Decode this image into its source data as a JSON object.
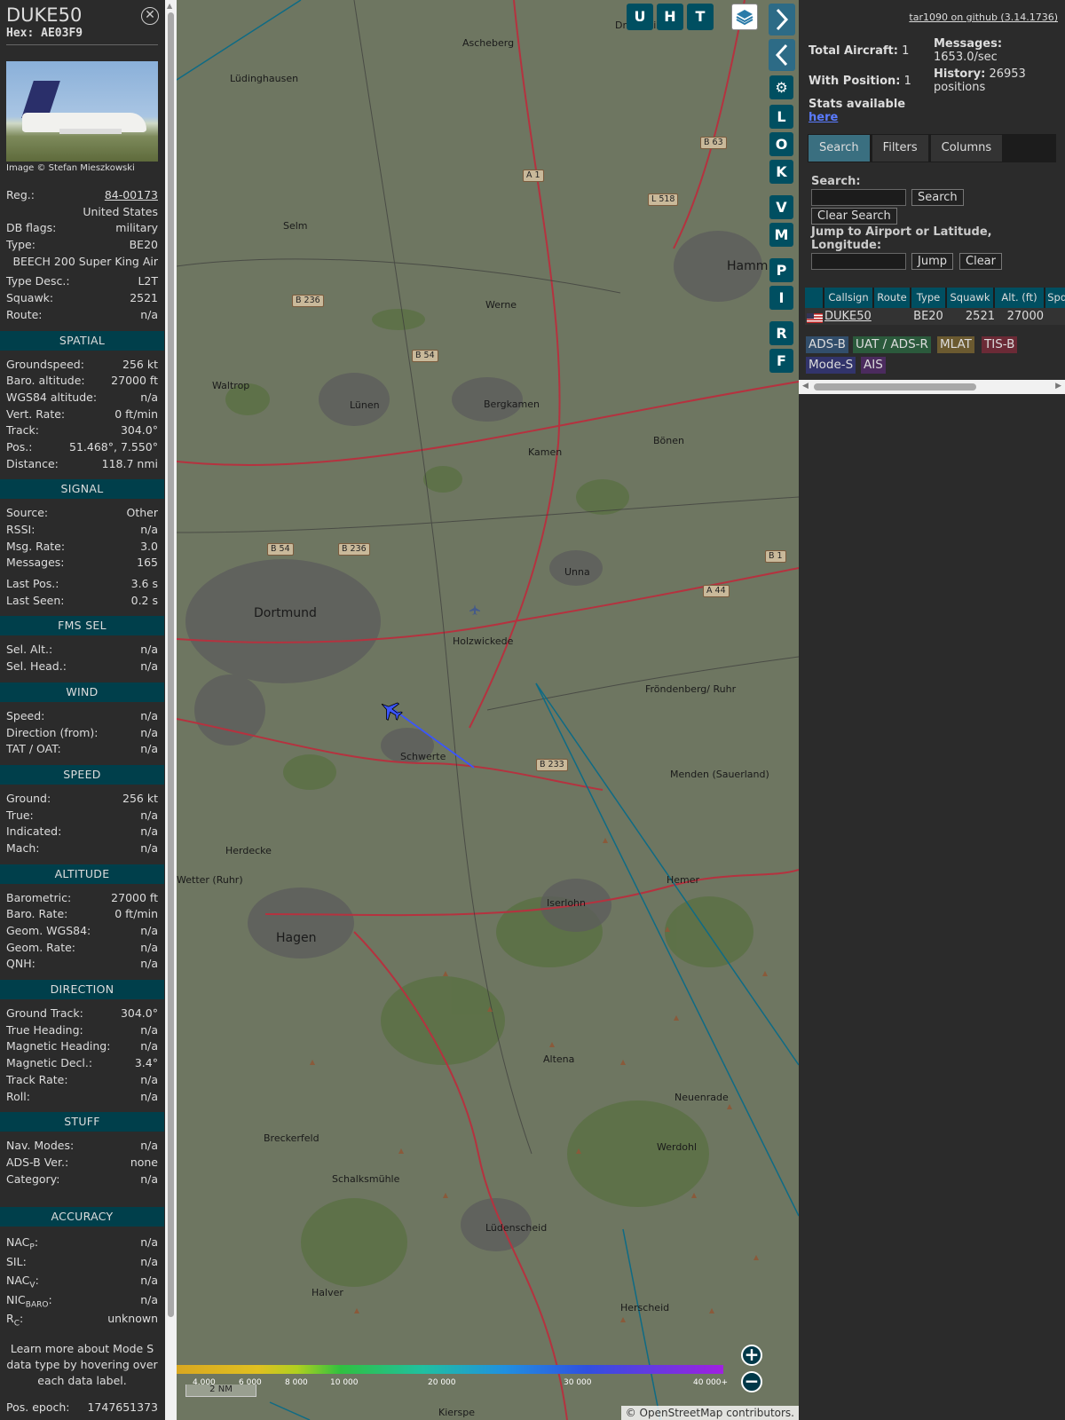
{
  "sidebar": {
    "callsign": "DUKE50",
    "hex": "Hex: AE03F9",
    "image_credit": "Image © Stefan Mieszkowski",
    "identity": [
      {
        "label": "Reg.:",
        "value": "84-00173"
      },
      {
        "label": "",
        "value": "United States"
      },
      {
        "label": "DB flags:",
        "value": "military"
      },
      {
        "label": "Type:",
        "value": "BE20"
      },
      {
        "label": "",
        "value": "BEECH 200 Super King Air"
      },
      {
        "label": "Type Desc.:",
        "value": "L2T"
      },
      {
        "label": "Squawk:",
        "value": "2521"
      },
      {
        "label": "Route:",
        "value": "n/a"
      }
    ],
    "sections": [
      {
        "title": "SPATIAL",
        "rows": [
          {
            "label": "Groundspeed:",
            "value": "256 kt"
          },
          {
            "label": "Baro. altitude:",
            "value": "27000 ft"
          },
          {
            "label": "WGS84 altitude:",
            "value": "n/a"
          },
          {
            "label": "Vert. Rate:",
            "value": "0 ft/min"
          },
          {
            "label": "Track:",
            "value": "304.0°"
          },
          {
            "label": "Pos.:",
            "value": "51.468°, 7.550°"
          },
          {
            "label": "Distance:",
            "value": "118.7 nmi"
          }
        ]
      },
      {
        "title": "SIGNAL",
        "rows": [
          {
            "label": "Source:",
            "value": "Other"
          },
          {
            "label": "RSSI:",
            "value": "n/a"
          },
          {
            "label": "Msg. Rate:",
            "value": "3.0"
          },
          {
            "label": "Messages:",
            "value": "165"
          },
          {
            "label": "Last Pos.:",
            "value": "3.6 s"
          },
          {
            "label": "Last Seen:",
            "value": "0.2 s"
          }
        ]
      },
      {
        "title": "FMS SEL",
        "rows": [
          {
            "label": "Sel. Alt.:",
            "value": "n/a"
          },
          {
            "label": "Sel. Head.:",
            "value": "n/a"
          }
        ]
      },
      {
        "title": "WIND",
        "rows": [
          {
            "label": "Speed:",
            "value": "n/a"
          },
          {
            "label": "Direction (from):",
            "value": "n/a"
          },
          {
            "label": "TAT / OAT:",
            "value": "n/a"
          }
        ]
      },
      {
        "title": "SPEED",
        "rows": [
          {
            "label": "Ground:",
            "value": "256 kt"
          },
          {
            "label": "True:",
            "value": "n/a"
          },
          {
            "label": "Indicated:",
            "value": "n/a"
          },
          {
            "label": "Mach:",
            "value": "n/a"
          }
        ]
      },
      {
        "title": "ALTITUDE",
        "rows": [
          {
            "label": "Barometric:",
            "value": "27000 ft"
          },
          {
            "label": "Baro. Rate:",
            "value": "0 ft/min"
          },
          {
            "label": "Geom. WGS84:",
            "value": "n/a"
          },
          {
            "label": "Geom. Rate:",
            "value": "n/a"
          },
          {
            "label": "QNH:",
            "value": "n/a"
          }
        ]
      },
      {
        "title": "DIRECTION",
        "rows": [
          {
            "label": "Ground Track:",
            "value": "304.0°"
          },
          {
            "label": "True Heading:",
            "value": "n/a"
          },
          {
            "label": "Magnetic Heading:",
            "value": "n/a"
          },
          {
            "label": "Magnetic Decl.:",
            "value": "3.4°"
          },
          {
            "label": "Track Rate:",
            "value": "n/a"
          },
          {
            "label": "Roll:",
            "value": "n/a"
          }
        ]
      },
      {
        "title": "STUFF",
        "rows": [
          {
            "label": "Nav. Modes:",
            "value": "n/a"
          },
          {
            "label": "ADS-B Ver.:",
            "value": "none"
          },
          {
            "label": "Category:",
            "value": "n/a"
          }
        ]
      }
    ],
    "accuracy": {
      "title": "ACCURACY",
      "rows": [
        {
          "label": "NAC",
          "sub": "P",
          "value": "n/a"
        },
        {
          "label": "SIL:",
          "sub": "",
          "value": "n/a"
        },
        {
          "label": "NAC",
          "sub": "V",
          "value": "n/a"
        },
        {
          "label": "NIC",
          "sub": "BARO",
          "value": "n/a"
        },
        {
          "label": "R",
          "sub": "C",
          "value": "unknown"
        }
      ]
    },
    "learn_more": "Learn more about Mode S data type by hovering over each data label.",
    "pos_epoch_label": "Pos. epoch:",
    "pos_epoch_value": "1747651373"
  },
  "map_buttons": {
    "top": [
      "U",
      "H",
      "T"
    ],
    "side": [
      "L",
      "O",
      "K",
      "V",
      "M",
      "P",
      "I",
      "R",
      "F"
    ],
    "icons": [
      "layers-icon",
      "chevron-right-icon",
      "chevron-left-icon",
      "expand-horizontal-icon",
      "gear-icon"
    ]
  },
  "map": {
    "towns": [
      "Drensteinfurt",
      "Ascheberg",
      "Lüdinghausen",
      "Selm",
      "Werne",
      "Hamm",
      "Waltrop",
      "Lünen",
      "Bergkamen",
      "Kamen",
      "Bönen",
      "Dortmund",
      "Holzwickede",
      "Unna",
      "Fröndenberg/ Ruhr",
      "Schwerte",
      "Menden (Sauerland)",
      "Herdecke",
      "Wetter (Ruhr)",
      "Hemer",
      "Iserlohn",
      "Hagen",
      "Altena",
      "Neuenrade",
      "Breckerfeld",
      "Werdohl",
      "Schalksmühle",
      "Lüdenscheid",
      "Halver",
      "Herscheid",
      "Kierspe"
    ],
    "road_signs": [
      "B 63",
      "A 1",
      "L 518",
      "B 236",
      "B 54",
      "B 54",
      "B 236",
      "A 44",
      "B 1",
      "B 233"
    ],
    "altitude_legend": [
      "4.000",
      "6 000",
      "8 000",
      "10 000",
      "20 000",
      "30 000",
      "40 000+"
    ],
    "scale": "2 NM",
    "attribution": "© OpenStreetMap contributors."
  },
  "right": {
    "version": "tar1090 on github (3.14.1736)",
    "total_aircraft_label": "Total Aircraft:",
    "total_aircraft": "1",
    "with_position_label": "With Position:",
    "with_position": "1",
    "messages_label": "Messages:",
    "messages_rate": "1653.0/sec",
    "history_label": "History:",
    "history_value": "26953",
    "history_unit": "positions",
    "stats_label": "Stats available",
    "stats_link": "here",
    "tabs": [
      "Search",
      "Filters",
      "Columns"
    ],
    "search_label": "Search:",
    "search_button": "Search",
    "clear_search_button": "Clear Search",
    "jump_label": "Jump to Airport or Latitude, Longitude:",
    "jump_button": "Jump",
    "clear_button": "Clear",
    "table": {
      "headers": [
        "Callsign",
        "Route",
        "Type",
        "Squawk",
        "Alt. (ft)",
        "Spd."
      ],
      "row": {
        "callsign": "DUKE50",
        "route": "",
        "type": "BE20",
        "squawk": "2521",
        "alt": "27000",
        "spd": ""
      }
    },
    "badges": [
      {
        "label": "ADS-B",
        "color": "#324e6b"
      },
      {
        "label": "UAT / ADS-R",
        "color": "#2b5a3c"
      },
      {
        "label": "MLAT",
        "color": "#6b5a30"
      },
      {
        "label": "TIS-B",
        "color": "#6b2a36"
      },
      {
        "label": "Mode-S",
        "color": "#32346b"
      },
      {
        "label": "AIS",
        "color": "#4b2b5e"
      }
    ]
  },
  "colors": {
    "accent": "#004f61",
    "section": "#003f4b",
    "track": "#3a55ff"
  }
}
